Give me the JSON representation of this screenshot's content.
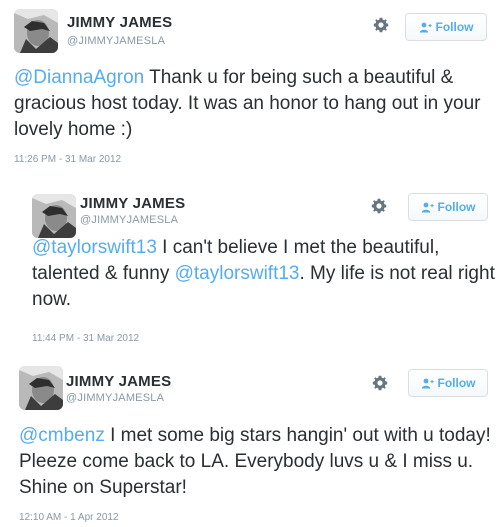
{
  "colors": {
    "accent": "#55acee",
    "text": "#292f33",
    "muted": "#8899a6",
    "button_border": "#dcdfe2"
  },
  "icons": {
    "settings": "gear-icon",
    "follow": "add-user-icon"
  },
  "tweets": [
    {
      "name": "JIMMY JAMES",
      "handle": "@JIMMYJAMESLA",
      "follow_label": "Follow",
      "mention": "@DiannaAgron",
      "text_1": " Thank u for being such a beautiful & gracious host today. It was an honor to hang out in your lovely home :)",
      "timestamp": "11:26 PM - 31 Mar 2012"
    },
    {
      "name": "JIMMY JAMES",
      "handle": "@JIMMYJAMESLA",
      "follow_label": "Follow",
      "mention": "@taylorswift13",
      "text_1": " I can't believe I met the beautiful, talented & funny ",
      "mention_2": "@taylorswift13",
      "text_2": ". My life is not real right now.",
      "timestamp": "11:44 PM - 31 Mar 2012"
    },
    {
      "name": "JIMMY JAMES",
      "handle": "@JIMMYJAMESLA",
      "follow_label": "Follow",
      "mention": "@cmbenz",
      "text_1": " I met some big stars hangin' out with u today! Pleeze come back to LA. Everybody luvs u & I miss u. Shine on Superstar!",
      "timestamp": "12:10 AM - 1 Apr 2012"
    }
  ]
}
